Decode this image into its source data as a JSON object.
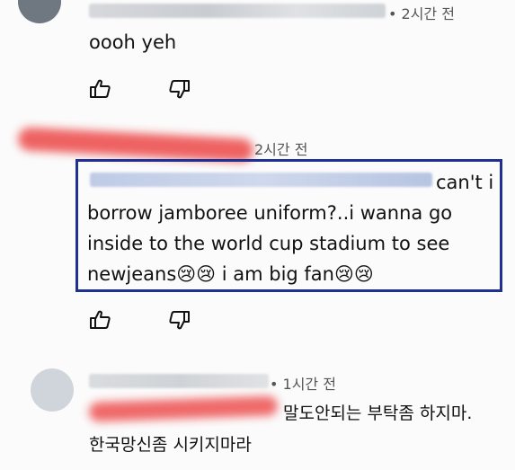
{
  "comments": [
    {
      "time": "• 2시간 전",
      "text": "oooh yeh"
    },
    {
      "time": "2시간 전",
      "text": "can't i borrow jamboree uniform?..i wanna go inside to the world cup stadium to see newjeans😢😢 i am big fan😢😢",
      "highlight_color": "#1f2f92"
    },
    {
      "time": "• 1시간 전",
      "line1": "말도안되는 부탁좀 하지마.",
      "line2": "한국망신좀 시키지마라"
    }
  ],
  "icons": {
    "like": "thumbs-up-icon",
    "dislike": "thumbs-down-icon"
  },
  "colors": {
    "redaction": "#ee5a5a",
    "box_border": "#1f2f92"
  }
}
